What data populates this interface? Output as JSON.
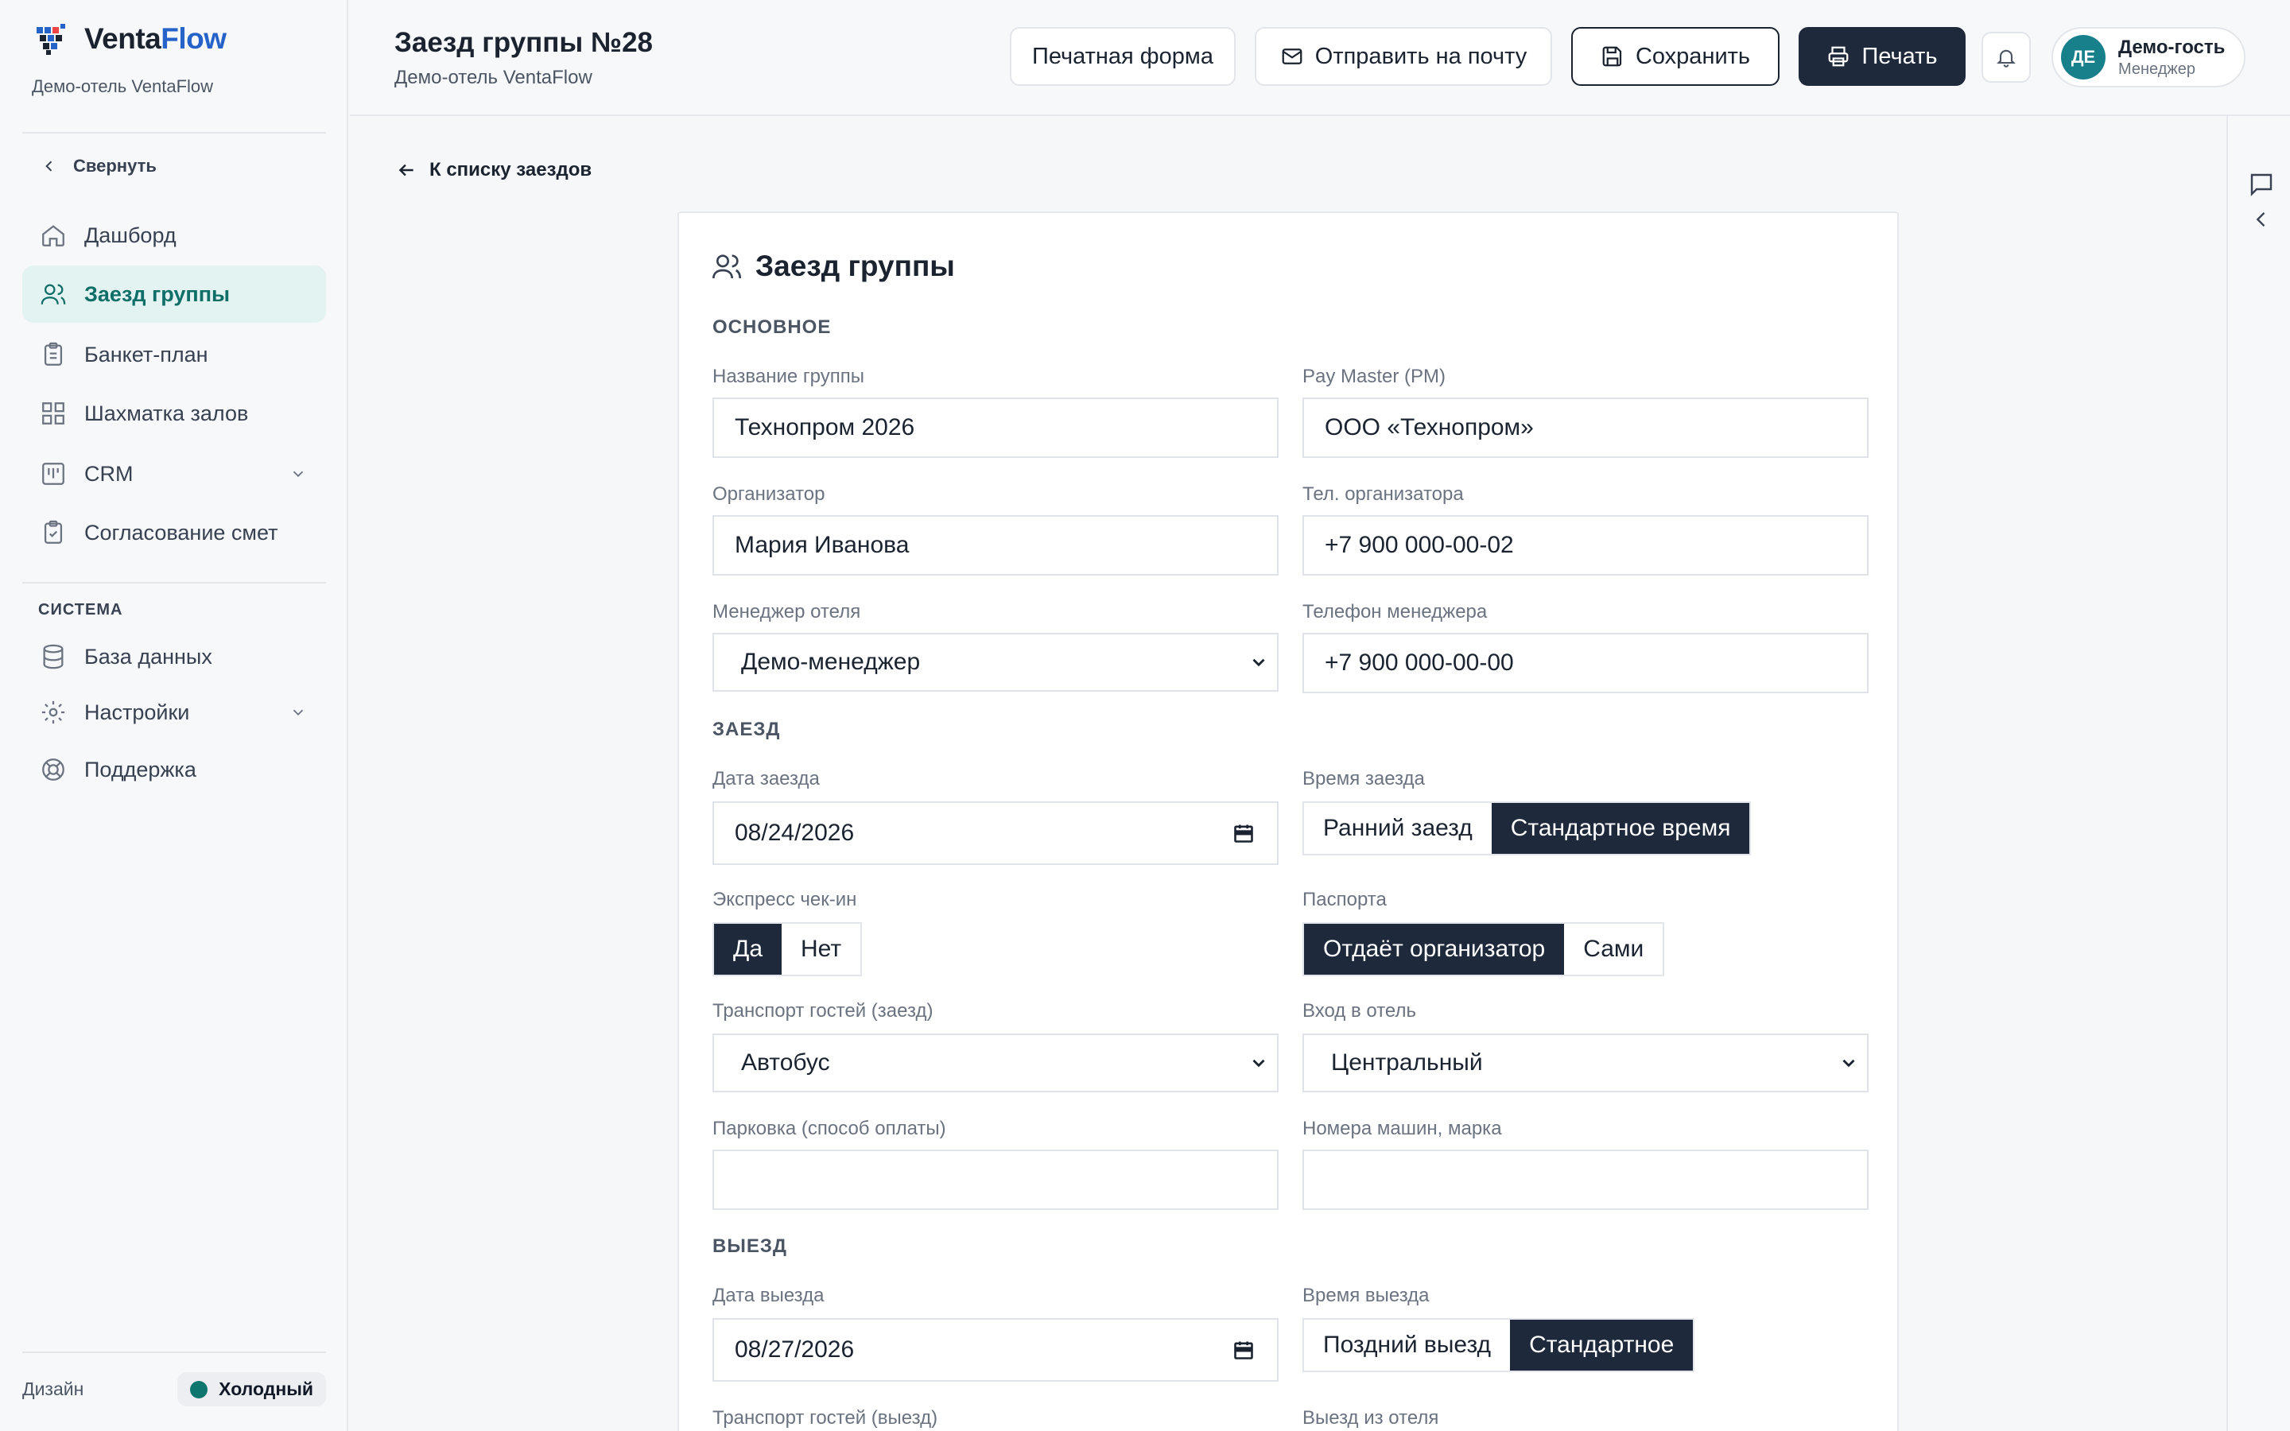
{
  "brand": {
    "name_part1": "Venta",
    "name_part2": "Flow",
    "hotel": "Демо-отель VentaFlow"
  },
  "sidebar": {
    "collapse_label": "Свернуть",
    "items": [
      {
        "label": "Дашборд",
        "icon": "home-icon"
      },
      {
        "label": "Заезд группы",
        "icon": "users-icon",
        "active": true
      },
      {
        "label": "Банкет-план",
        "icon": "clipboard-icon"
      },
      {
        "label": "Шахматка залов",
        "icon": "grid-icon"
      },
      {
        "label": "CRM",
        "icon": "kanban-icon",
        "expandable": true
      },
      {
        "label": "Согласование смет",
        "icon": "clipboard-check-icon"
      }
    ],
    "section_title": "СИСТЕМА",
    "system_items": [
      {
        "label": "База данных",
        "icon": "database-icon"
      },
      {
        "label": "Настройки",
        "icon": "gear-icon",
        "expandable": true
      },
      {
        "label": "Поддержка",
        "icon": "lifebuoy-icon"
      }
    ],
    "design_label": "Дизайн",
    "theme_label": "Холодный",
    "theme_color": "#0f766e"
  },
  "header": {
    "title": "Заезд группы №28",
    "subtitle": "Демо-отель VentaFlow",
    "print_form_label": "Печатная форма",
    "email_label": "Отправить на почту",
    "save_label": "Сохранить",
    "print_label": "Печать",
    "user": {
      "initials": "ДЕ",
      "name": "Демо-гость",
      "role": "Менеджер"
    }
  },
  "back_label": "К списку заездов",
  "form": {
    "title": "Заезд группы",
    "sections": {
      "main": "ОСНОВНОЕ",
      "checkin": "ЗАЕЗД",
      "checkout": "ВЫЕЗД"
    },
    "group_name": {
      "label": "Название группы",
      "value": "Технопром 2026"
    },
    "pay_master": {
      "label": "Pay Master (PM)",
      "value": "ООО «Технопром»"
    },
    "organizer": {
      "label": "Организатор",
      "value": "Мария Иванова"
    },
    "organizer_phone": {
      "label": "Тел. организатора",
      "value": "+7 900 000-00-02"
    },
    "hotel_manager": {
      "label": "Менеджер отеля",
      "value": "Демо-менеджер"
    },
    "manager_phone": {
      "label": "Телефон менеджера",
      "value": "+7 900 000-00-00"
    },
    "checkin_date": {
      "label": "Дата заезда",
      "value": "08/24/2026"
    },
    "checkin_time": {
      "label": "Время заезда",
      "options": [
        "Ранний заезд",
        "Стандартное время"
      ],
      "selected": 1
    },
    "express_checkin": {
      "label": "Экспресс чек-ин",
      "options": [
        "Да",
        "Нет"
      ],
      "selected": 0
    },
    "passports": {
      "label": "Паспорта",
      "options": [
        "Отдаёт организатор",
        "Сами"
      ],
      "selected": 0
    },
    "transport_in": {
      "label": "Транспорт гостей (заезд)",
      "value": "Автобус"
    },
    "hotel_entrance": {
      "label": "Вход в отель",
      "value": "Центральный"
    },
    "parking": {
      "label": "Парковка (способ оплаты)",
      "value": ""
    },
    "car_numbers": {
      "label": "Номера машин, марка",
      "value": ""
    },
    "checkout_date": {
      "label": "Дата выезда",
      "value": "08/27/2026"
    },
    "checkout_time": {
      "label": "Время выезда",
      "options": [
        "Поздний выезд",
        "Стандартное"
      ],
      "selected": 1
    },
    "transport_out": {
      "label": "Транспорт гостей (выезд)"
    },
    "hotel_exit": {
      "label": "Выезд из отеля"
    }
  }
}
